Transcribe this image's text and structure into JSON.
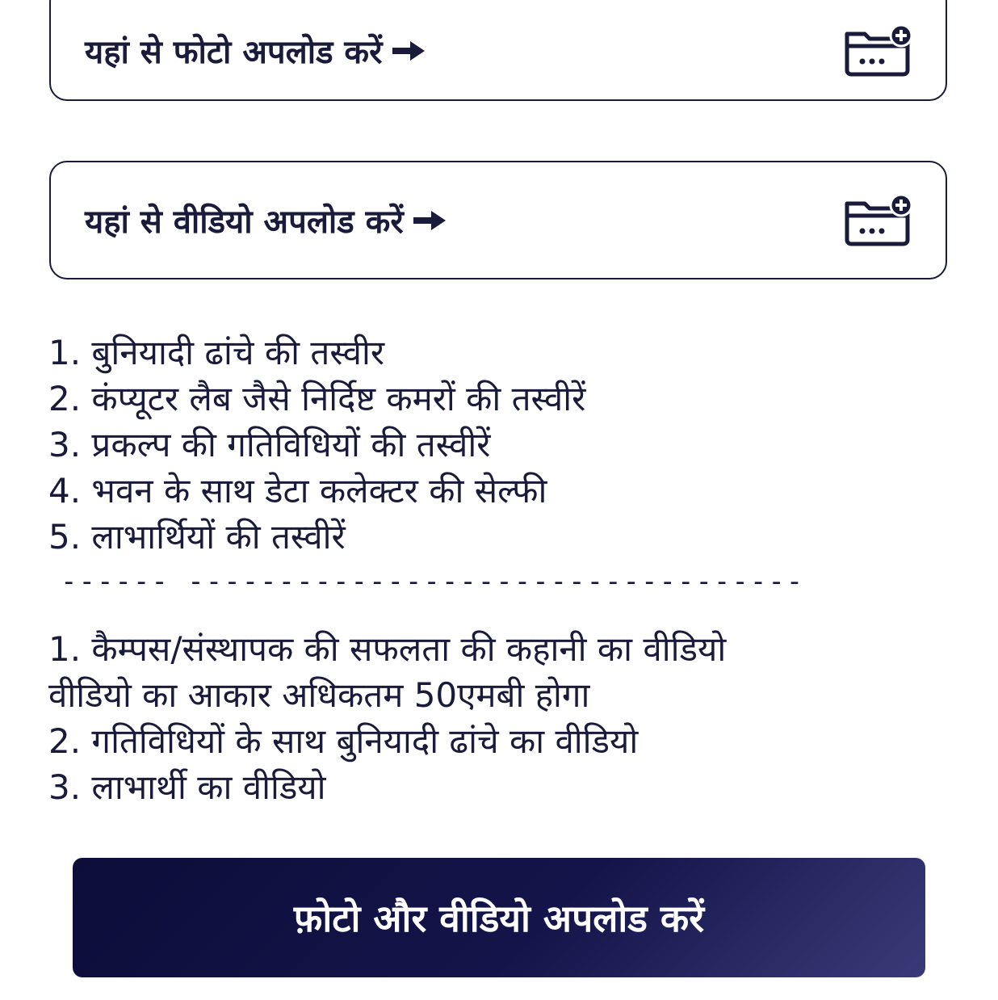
{
  "photo_upload": {
    "label": "यहां से फोटो अपलोड करें",
    "arrow_icon": "arrow-right-icon",
    "folder_icon": "folder-add-icon"
  },
  "video_upload": {
    "label": "यहां से वीडियो अपलोड करें",
    "arrow_icon": "arrow-right-icon",
    "folder_icon": "folder-add-icon"
  },
  "photo_requirements": [
    "1. बुनियादी ढांचे की तस्वीर",
    "2. कंप्यूटर लैब जैसे निर्दिष्ट कमरों की तस्वीरें",
    "3. प्रकल्प की गतिविधियों की तस्वीरें",
    "4. भवन के साथ डेटा कलेक्टर की सेल्फी",
    "5. लाभार्थियों की तस्वीरें"
  ],
  "divider": "------ ----------------------------------",
  "video_requirements": [
    "1. कैम्पस/संस्थापक की सफलता की कहानी का वीडियो",
    "वीडियो का आकार अधिकतम 50एमबी होगा",
    "2. गतिविधियों के साथ बुनियादी ढांचे का वीडियो",
    "3. लाभार्थी का वीडियो"
  ],
  "submit": {
    "label": "फ़ोटो और वीडियो अपलोड करें"
  },
  "colors": {
    "text": "#1a1a3a",
    "button_bg": "#14144a",
    "button_text": "#ffffff"
  }
}
